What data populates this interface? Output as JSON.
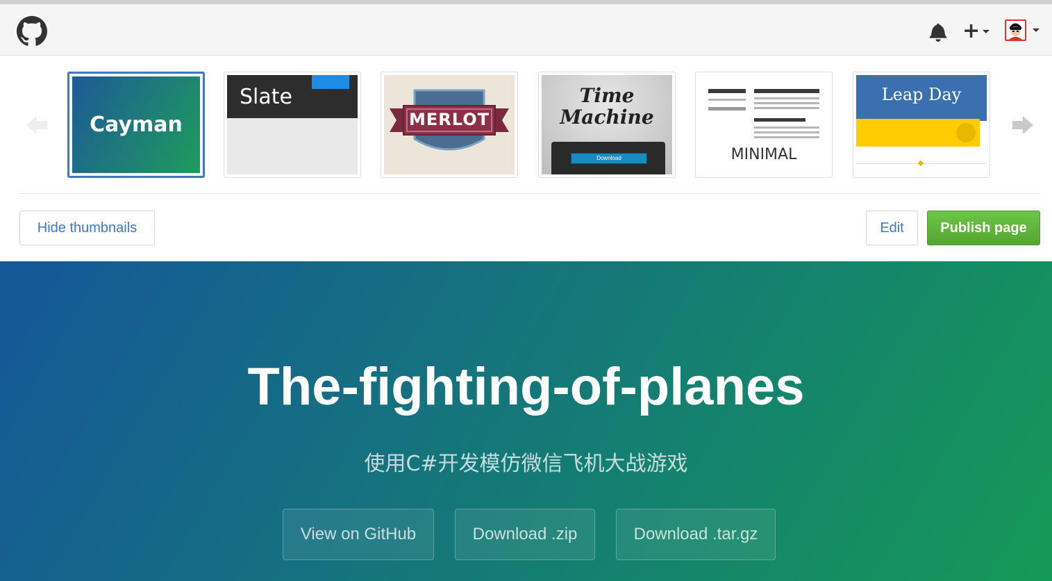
{
  "header": {
    "logo_icon": "github-octocat-icon",
    "notifications_icon": "bell-icon",
    "new_menu_icon": "plus-icon",
    "avatar_icon": "user-avatar"
  },
  "theme_chooser": {
    "prev_icon": "arrow-left-icon",
    "next_icon": "arrow-right-icon",
    "selected": "Cayman",
    "themes": [
      {
        "name": "Cayman"
      },
      {
        "name": "Slate"
      },
      {
        "name": "MERLOT"
      },
      {
        "name_line1": "Time",
        "name_line2": "Machine",
        "download_label": "Download"
      },
      {
        "name": "MINIMAL"
      },
      {
        "name": "Leap Day"
      }
    ],
    "hide_thumbnails_label": "Hide thumbnails",
    "edit_label": "Edit",
    "publish_label": "Publish page"
  },
  "hero": {
    "title": "The-fighting-of-planes",
    "tagline": "使用C#开发模仿微信飞机大战游戏",
    "buttons": [
      "View on GitHub",
      "Download .zip",
      "Download .tar.gz"
    ],
    "gradient_start": "#155799",
    "gradient_end": "#159957"
  },
  "colors": {
    "accent": "#4078c0",
    "publish_green": "#6cc644"
  }
}
